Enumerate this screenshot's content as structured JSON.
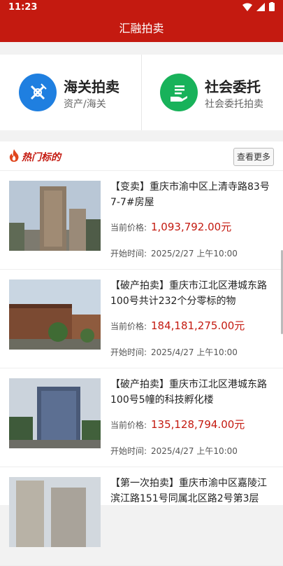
{
  "status": {
    "time": "11:23"
  },
  "app": {
    "title": "汇融拍卖"
  },
  "categories": [
    {
      "title": "海关拍卖",
      "subtitle": "资产/海关",
      "icon": "customs-icon",
      "color": "#1f7fe0"
    },
    {
      "title": "社会委托",
      "subtitle": "社会委托拍卖",
      "icon": "hand-list-icon",
      "color": "#18b25a"
    }
  ],
  "hot": {
    "title": "热门标的",
    "more_label": "查看更多"
  },
  "items": [
    {
      "title": "【变卖】重庆市渝中区上清寺路83号7-7#房屋",
      "price_label": "当前价格:",
      "price": "1,093,792.00元",
      "start_label": "开始时间:",
      "start_time": "2025/2/27 上午10:00"
    },
    {
      "title": "【破产拍卖】重庆市江北区港城东路100号共计232个分零标的物",
      "price_label": "当前价格:",
      "price": "184,181,275.00元",
      "start_label": "开始时间:",
      "start_time": "2025/4/27 上午10:00"
    },
    {
      "title": "【破产拍卖】重庆市江北区港城东路100号5幢的科技孵化楼",
      "price_label": "当前价格:",
      "price": "135,128,794.00元",
      "start_label": "开始时间:",
      "start_time": "2025/4/27 上午10:00"
    },
    {
      "title": "【第一次拍卖】重庆市渝中区嘉陵江滨江路151号同属北区路2号第3层",
      "price_label": "",
      "price": "",
      "start_label": "",
      "start_time": ""
    }
  ],
  "colors": {
    "brand": "#c41a10"
  }
}
